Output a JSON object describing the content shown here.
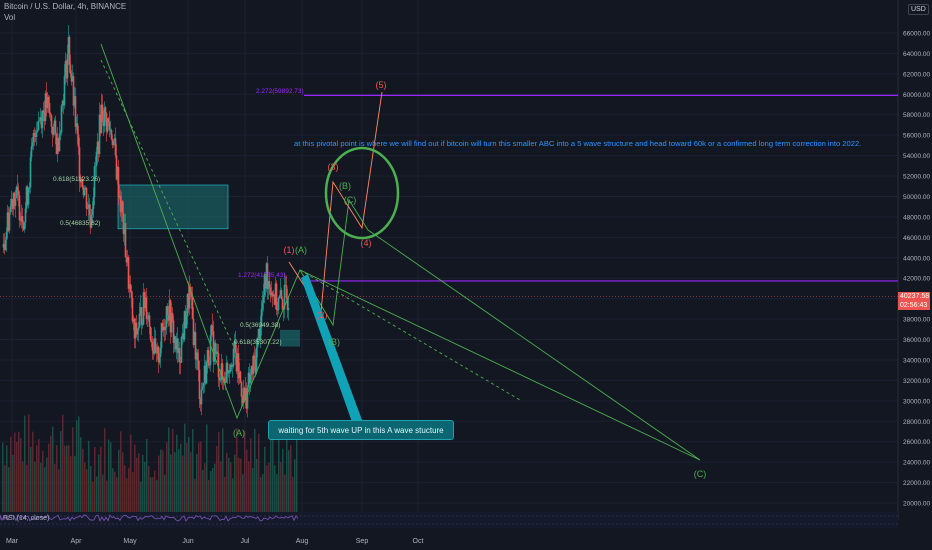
{
  "header": {
    "symbol": "Bitcoin / U.S. Dollar, 4h, BINANCE",
    "volume_label": "Vol",
    "currency": "USD"
  },
  "colors": {
    "background": "#131722",
    "up_candle": "#26a69a",
    "down_candle": "#ef5350",
    "wave_line": "#4caf50",
    "purple_level": "#9c27ff",
    "red_label": "#ef5350",
    "cyan_box": "#1b8a86",
    "arrow": "#10a3b7"
  },
  "rsi_label": "RSI (14, close)",
  "current_price": {
    "value": "40237.58",
    "countdown": "02:56:43"
  },
  "annotations": {
    "pivot_note": "at this pivotal point is where we will find out if bitcoin will turn this smaller  ABC into a 5 wave structure and head toward 60k or a confirmed long term correction into 2022.",
    "callout": "waiting for 5th wave UP in this A wave stucture"
  },
  "fib_labels": [
    {
      "text": "2.272(59892.73)",
      "color": "#9c27ff"
    },
    {
      "text": "0.618(51123.26)",
      "color": "#a5d6a7"
    },
    {
      "text": "0.5(46835.82)",
      "color": "#a5d6a7"
    },
    {
      "text": "1.272(41735.43)",
      "color": "#9c27ff"
    },
    {
      "text": "0.5(36949.38)",
      "color": "#a5d6a7"
    },
    {
      "text": "0.618(35307.22)",
      "color": "#a5d6a7"
    }
  ],
  "wave_labels": [
    {
      "text": "(5)",
      "color": "#ef5350"
    },
    {
      "text": "(3)",
      "color": "#ef5350"
    },
    {
      "text": "(B)",
      "color": "#4caf50"
    },
    {
      "text": "(C)",
      "color": "#4caf50"
    },
    {
      "text": "(4)",
      "color": "#ef5350"
    },
    {
      "text": "(1)",
      "color": "#ef5350"
    },
    {
      "text": "(A)",
      "color": "#4caf50"
    },
    {
      "text": "(2)",
      "color": "#ef5350"
    },
    {
      "text": "(B)",
      "color": "#4caf50"
    },
    {
      "text": "(A)",
      "color": "#4caf50"
    },
    {
      "text": "(C)",
      "color": "#4caf50"
    }
  ],
  "chart_data": {
    "type": "candlestick",
    "ylim": [
      19000,
      67000
    ],
    "y_ticks": [
      "66000.00",
      "64000.00",
      "62000.00",
      "60000.00",
      "58000.00",
      "56000.00",
      "54000.00",
      "52000.00",
      "50000.00",
      "48000.00",
      "46000.00",
      "44000.00",
      "42000.00",
      "40000.00",
      "38000.00",
      "36000.00",
      "34000.00",
      "32000.00",
      "30000.00",
      "28000.00",
      "26000.00",
      "24000.00",
      "22000.00",
      "20000.00"
    ],
    "x_ticks": [
      "Mar",
      "Apr",
      "May",
      "Jun",
      "Jul",
      "Aug",
      "Sep",
      "Oct"
    ],
    "horizontal_levels": [
      59892.73,
      41735.43
    ],
    "fib_zone_upper": [
      51123.26,
      46835.82
    ],
    "fib_zone_lower": [
      36949.38,
      35307.22
    ],
    "price_path": [
      {
        "t": "Mar",
        "p": 45000
      },
      {
        "t": "Mar",
        "p": 50500
      },
      {
        "t": "Mar",
        "p": 48000
      },
      {
        "t": "Mar",
        "p": 57000
      },
      {
        "t": "Apr",
        "p": 59000
      },
      {
        "t": "Apr",
        "p": 55000
      },
      {
        "t": "Apr",
        "p": 64800
      },
      {
        "t": "Apr",
        "p": 53000
      },
      {
        "t": "Apr",
        "p": 48000
      },
      {
        "t": "May",
        "p": 58500
      },
      {
        "t": "May",
        "p": 56000
      },
      {
        "t": "May",
        "p": 47000
      },
      {
        "t": "May",
        "p": 36000
      },
      {
        "t": "May",
        "p": 40000
      },
      {
        "t": "Jun",
        "p": 33500
      },
      {
        "t": "Jun",
        "p": 39500
      },
      {
        "t": "Jun",
        "p": 34000
      },
      {
        "t": "Jun",
        "p": 40500
      },
      {
        "t": "Jun",
        "p": 30500
      },
      {
        "t": "Jul",
        "p": 36000
      },
      {
        "t": "Jul",
        "p": 32000
      },
      {
        "t": "Jul",
        "p": 35000
      },
      {
        "t": "Jul",
        "p": 30000
      },
      {
        "t": "Jul",
        "p": 34000
      },
      {
        "t": "Jul",
        "p": 42500
      },
      {
        "t": "Aug",
        "p": 39500
      },
      {
        "t": "Aug",
        "p": 40237.58
      }
    ]
  }
}
